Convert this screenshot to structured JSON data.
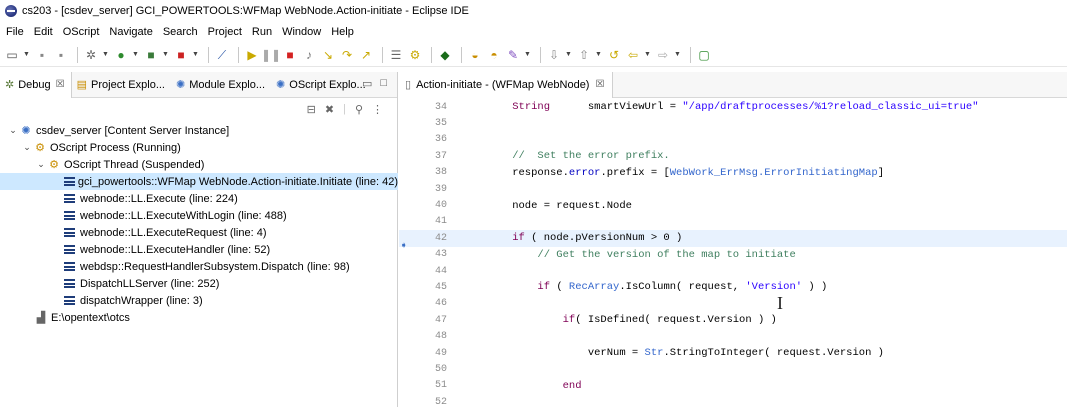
{
  "window": {
    "title": "cs203 - [csdev_server] GCI_POWERTOOLS:WFMap WebNode.Action-initiate - Eclipse IDE"
  },
  "menu": [
    "File",
    "Edit",
    "OScript",
    "Navigate",
    "Search",
    "Project",
    "Run",
    "Window",
    "Help"
  ],
  "left_tabs": [
    {
      "label": "Debug",
      "icon": "debug-icon",
      "active": true,
      "close": "☒"
    },
    {
      "label": "Project Explo...",
      "icon": "project-explorer-icon"
    },
    {
      "label": "Module Explo...",
      "icon": "module-explorer-icon"
    },
    {
      "label": "OScript Explo...",
      "icon": "oscript-explorer-icon"
    }
  ],
  "tree": {
    "server": "csdev_server [Content Server Instance]",
    "process": "OScript Process (Running)",
    "thread": "OScript Thread (Suspended)",
    "frames": [
      "gci_powertools::WFMap WebNode.Action-initiate.Initiate (line: 42)",
      "webnode::LL.Execute (line: 224)",
      "webnode::LL.ExecuteWithLogin (line: 488)",
      "webnode::LL.ExecuteRequest (line: 4)",
      "webnode::LL.ExecuteHandler (line: 52)",
      "webdsp::RequestHandlerSubsystem.Dispatch (line: 98)",
      "DispatchLLServer (line: 252)",
      "dispatchWrapper (line: 3)"
    ],
    "path": "E:\\opentext\\otcs"
  },
  "editor": {
    "tab_label": "Action-initiate - (WFMap WebNode)",
    "current_line": 42
  },
  "code_lines": [
    {
      "n": "34",
      "parts": [
        [
          "txt",
          "    "
        ],
        [
          "kw",
          "String"
        ],
        [
          "txt",
          "      smartViewUrl = "
        ],
        [
          "str",
          "\"/app/draftprocesses/%1?reload_classic_ui=true\""
        ]
      ]
    },
    {
      "n": "35",
      "parts": []
    },
    {
      "n": "36",
      "parts": []
    },
    {
      "n": "37",
      "parts": [
        [
          "cm",
          "    //  Set the error prefix."
        ]
      ]
    },
    {
      "n": "38",
      "parts": [
        [
          "txt",
          "    response."
        ],
        [
          "fld",
          "error"
        ],
        [
          "txt",
          ".prefix = ["
        ],
        [
          "cls",
          "WebWork_ErrMsg.ErrorInitiatingMap"
        ],
        [
          "txt",
          "]"
        ]
      ]
    },
    {
      "n": "39",
      "parts": []
    },
    {
      "n": "40",
      "parts": [
        [
          "txt",
          "    node = request.Node"
        ]
      ]
    },
    {
      "n": "41",
      "parts": []
    },
    {
      "n": "42",
      "parts": [
        [
          "kw",
          "    if"
        ],
        [
          "txt",
          " ( node.pVersionNum > 0 )"
        ]
      ]
    },
    {
      "n": "43",
      "parts": [
        [
          "cm",
          "        // Get the version of the map to initiate"
        ]
      ]
    },
    {
      "n": "44",
      "parts": []
    },
    {
      "n": "45",
      "parts": [
        [
          "kw",
          "        if"
        ],
        [
          "txt",
          " ( "
        ],
        [
          "cls",
          "RecArray"
        ],
        [
          "txt",
          ".IsColumn( request, "
        ],
        [
          "str",
          "'Version'"
        ],
        [
          "txt",
          " ) )"
        ]
      ]
    },
    {
      "n": "46",
      "parts": []
    },
    {
      "n": "47",
      "parts": [
        [
          "kw",
          "            if"
        ],
        [
          "txt",
          "( IsDefined( request.Version ) )"
        ]
      ]
    },
    {
      "n": "48",
      "parts": []
    },
    {
      "n": "49",
      "parts": [
        [
          "txt",
          "                verNum = "
        ],
        [
          "cls",
          "Str"
        ],
        [
          "txt",
          ".StringToInteger( request.Version )"
        ]
      ]
    },
    {
      "n": "50",
      "parts": []
    },
    {
      "n": "51",
      "parts": [
        [
          "kw",
          "            end"
        ]
      ]
    },
    {
      "n": "52",
      "parts": []
    }
  ]
}
